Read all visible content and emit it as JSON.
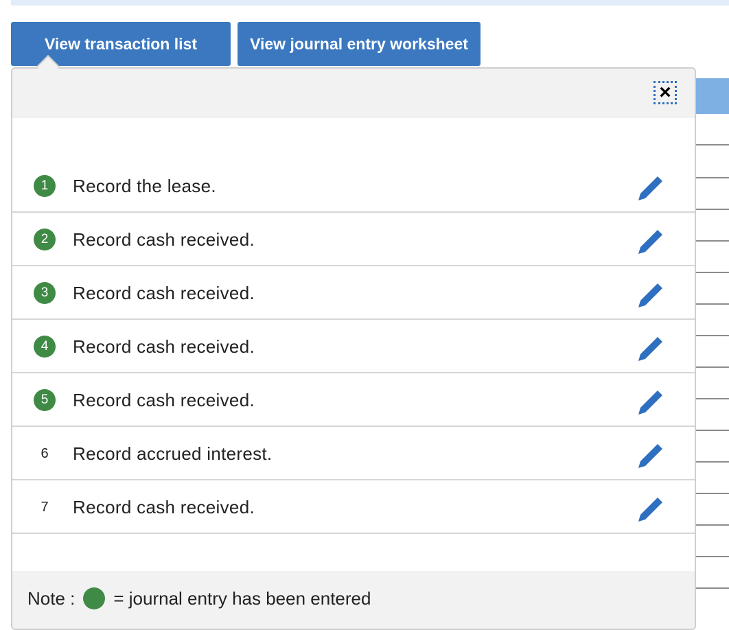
{
  "tabs": {
    "transactions_label": "View transaction list",
    "worksheet_label": "View journal entry worksheet"
  },
  "popup": {
    "close_glyph": "×",
    "items": [
      {
        "number": "1",
        "text": "Record the lease.",
        "entered": true,
        "icon": "pencil-icon"
      },
      {
        "number": "2",
        "text": "Record cash received.",
        "entered": true,
        "icon": "pencil-icon"
      },
      {
        "number": "3",
        "text": "Record cash received.",
        "entered": true,
        "icon": "pencil-icon"
      },
      {
        "number": "4",
        "text": "Record cash received.",
        "entered": true,
        "icon": "pencil-icon"
      },
      {
        "number": "5",
        "text": "Record cash received.",
        "entered": true,
        "icon": "pencil-icon"
      },
      {
        "number": "6",
        "text": "Record accrued interest.",
        "entered": false,
        "icon": "pencil-icon"
      },
      {
        "number": "7",
        "text": "Record cash received.",
        "entered": false,
        "icon": "pencil-icon"
      }
    ],
    "note": {
      "prefix": "Note :",
      "suffix": "= journal entry has been entered"
    }
  },
  "colors": {
    "button_blue": "#3b78c0",
    "entered_green": "#3f8a44",
    "pencil_blue": "#2f6fc0",
    "panel_gray": "#f2f2f2"
  }
}
